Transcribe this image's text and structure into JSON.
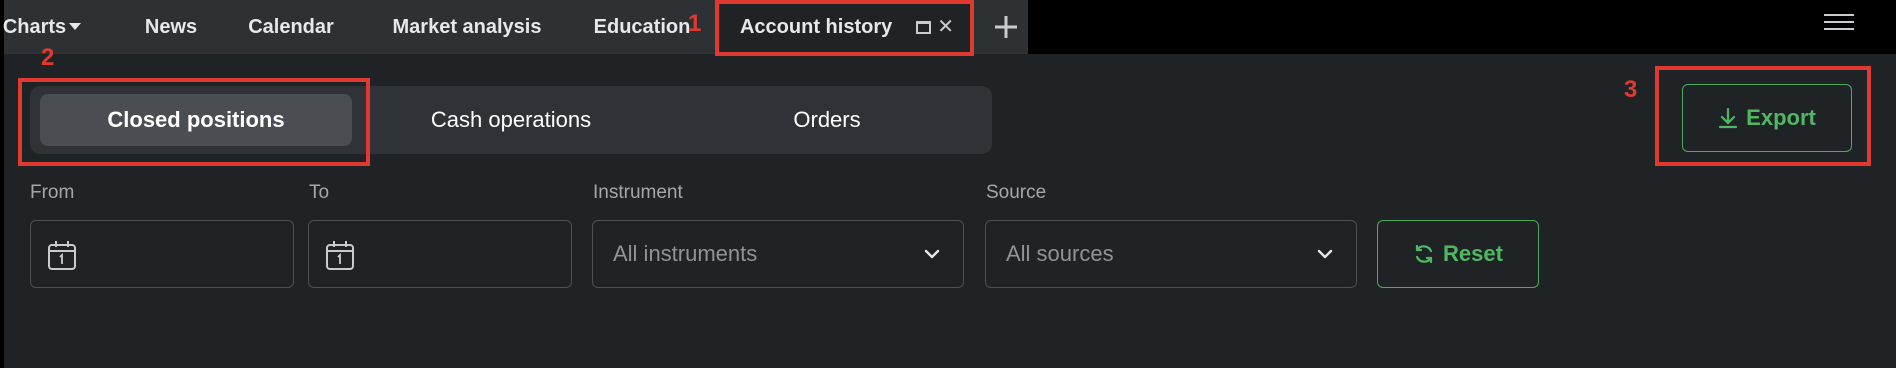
{
  "tabs": [
    {
      "label": "Charts"
    },
    {
      "label": "News"
    },
    {
      "label": "Calendar"
    },
    {
      "label": "Market analysis"
    },
    {
      "label": "Education"
    },
    {
      "label": "Account history"
    }
  ],
  "history": {
    "segments": [
      "Closed positions",
      "Cash operations",
      "Orders"
    ],
    "active_segment": "Closed positions",
    "export_label": "Export",
    "filters": {
      "from_label": "From",
      "to_label": "To",
      "instrument_label": "Instrument",
      "instrument_value": "All instruments",
      "source_label": "Source",
      "source_value": "All sources",
      "reset_label": "Reset"
    }
  },
  "annotations": [
    "1",
    "2",
    "3"
  ],
  "colors": {
    "accent_green": "#4fb860",
    "annotation_red": "#e03a30",
    "panel_bg": "#1f2326"
  },
  "icons": [
    "caret-down-icon",
    "maximize-icon",
    "close-icon",
    "plus-icon",
    "hamburger-menu-icon",
    "download-icon",
    "calendar-icon",
    "chevron-down-icon",
    "refresh-icon"
  ]
}
